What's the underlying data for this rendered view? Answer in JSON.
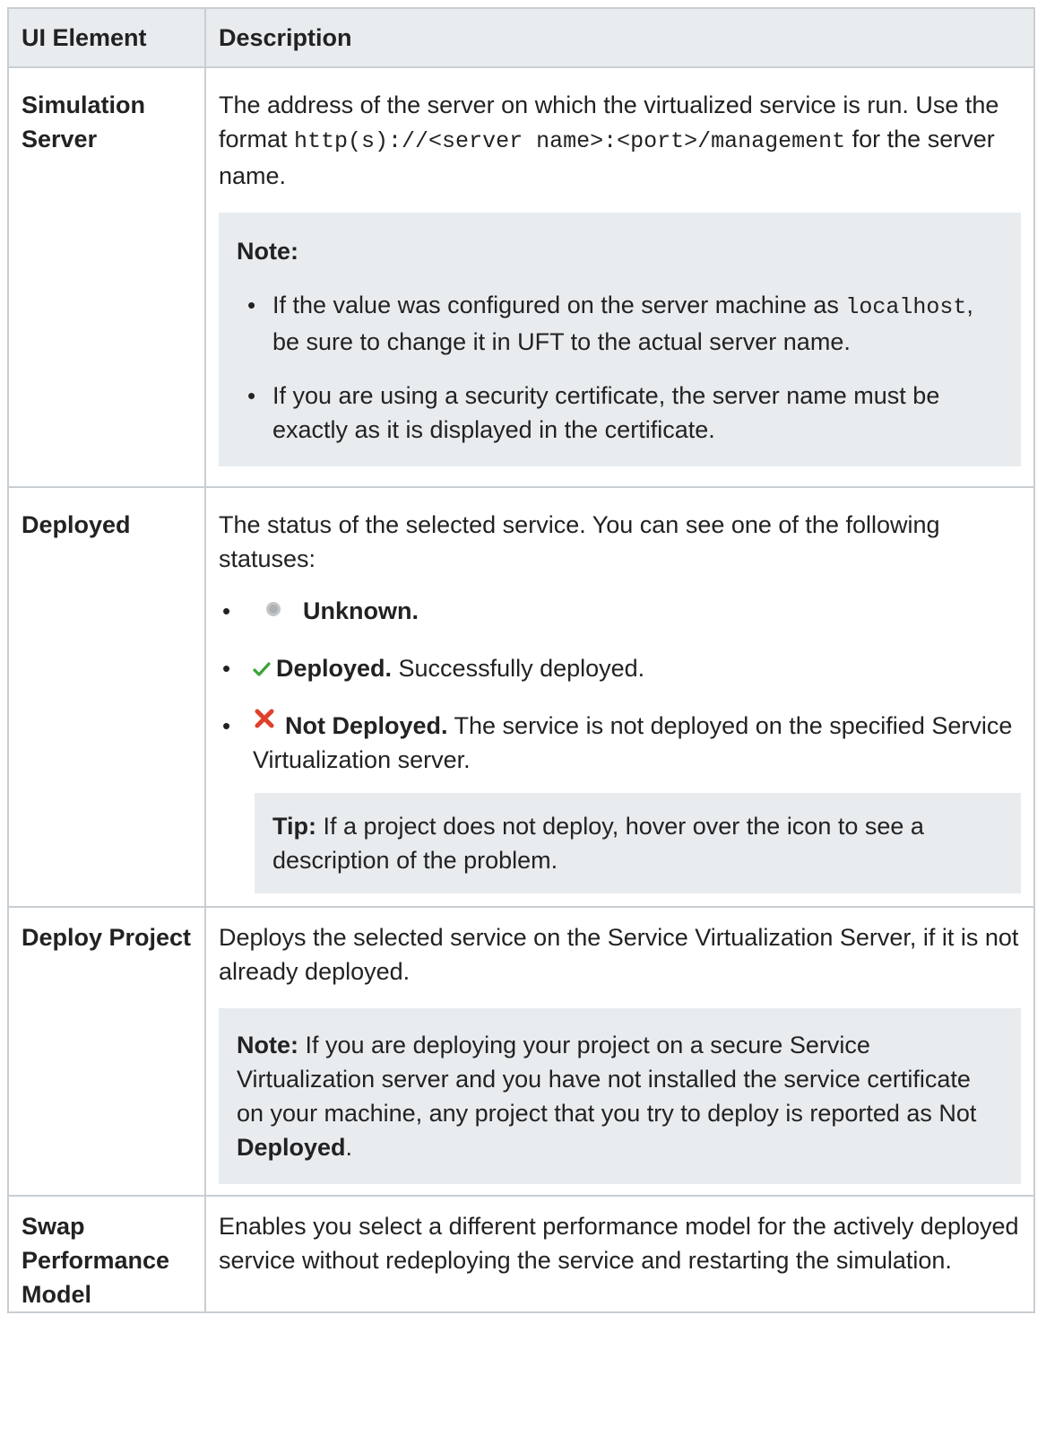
{
  "table": {
    "headers": {
      "element": "UI Element",
      "description": "Description"
    },
    "rows": {
      "simulation_server": {
        "element": "Simulation Server",
        "desc_1": "The address of the server on which the virtualized service is run. Use the format ",
        "desc_code": "http(s)://<server name>:<port>/management",
        "desc_2": " for the server name.",
        "note_heading": "Note:",
        "bullet1_a": "If the value was configured on the server machine as ",
        "bullet1_code": "localhost",
        "bullet1_b": ", be sure to change it in UFT to the actual server name.",
        "bullet2": "If you are using a security certificate, the server name must be exactly as it is displayed in the certificate."
      },
      "deployed": {
        "element": "Deployed",
        "desc": "The status of the selected service. You can see one of the following statuses:",
        "status_unknown": "Unknown.",
        "status_deployed_label": "Deployed.",
        "status_deployed_text": " Successfully deployed.",
        "status_not_label": "Not Deployed.",
        "status_not_text": " The service is not deployed on the specified Service Virtualization server.",
        "tip_label": "Tip:",
        "tip_text": " If a project does not deploy, hover over the icon to see a description of the problem."
      },
      "deploy_project": {
        "element": "Deploy Project",
        "desc": "Deploys the selected service on the Service Virtualization Server, if it is not already deployed.",
        "note_label": "Note:",
        "note_text": " If you are deploying your project on a secure Service Virtualization server and you have not installed the service certificate on your machine, any project that you try to deploy is reported as Not ",
        "note_bold": "Deployed",
        "note_end": "."
      },
      "swap_model": {
        "element": "Swap Performance Model",
        "desc": "Enables you select a different performance model for the actively deployed service without redeploying the service and restarting the simulation."
      }
    }
  },
  "icons": {
    "unknown": "gray-circle-icon",
    "deployed": "green-check-icon",
    "not_deployed": "red-x-icon"
  },
  "colors": {
    "header_bg": "#e8ecef",
    "note_bg": "#e8ecef",
    "border": "#c9ced3",
    "check": "#3aa336",
    "x": "#e0402a"
  }
}
